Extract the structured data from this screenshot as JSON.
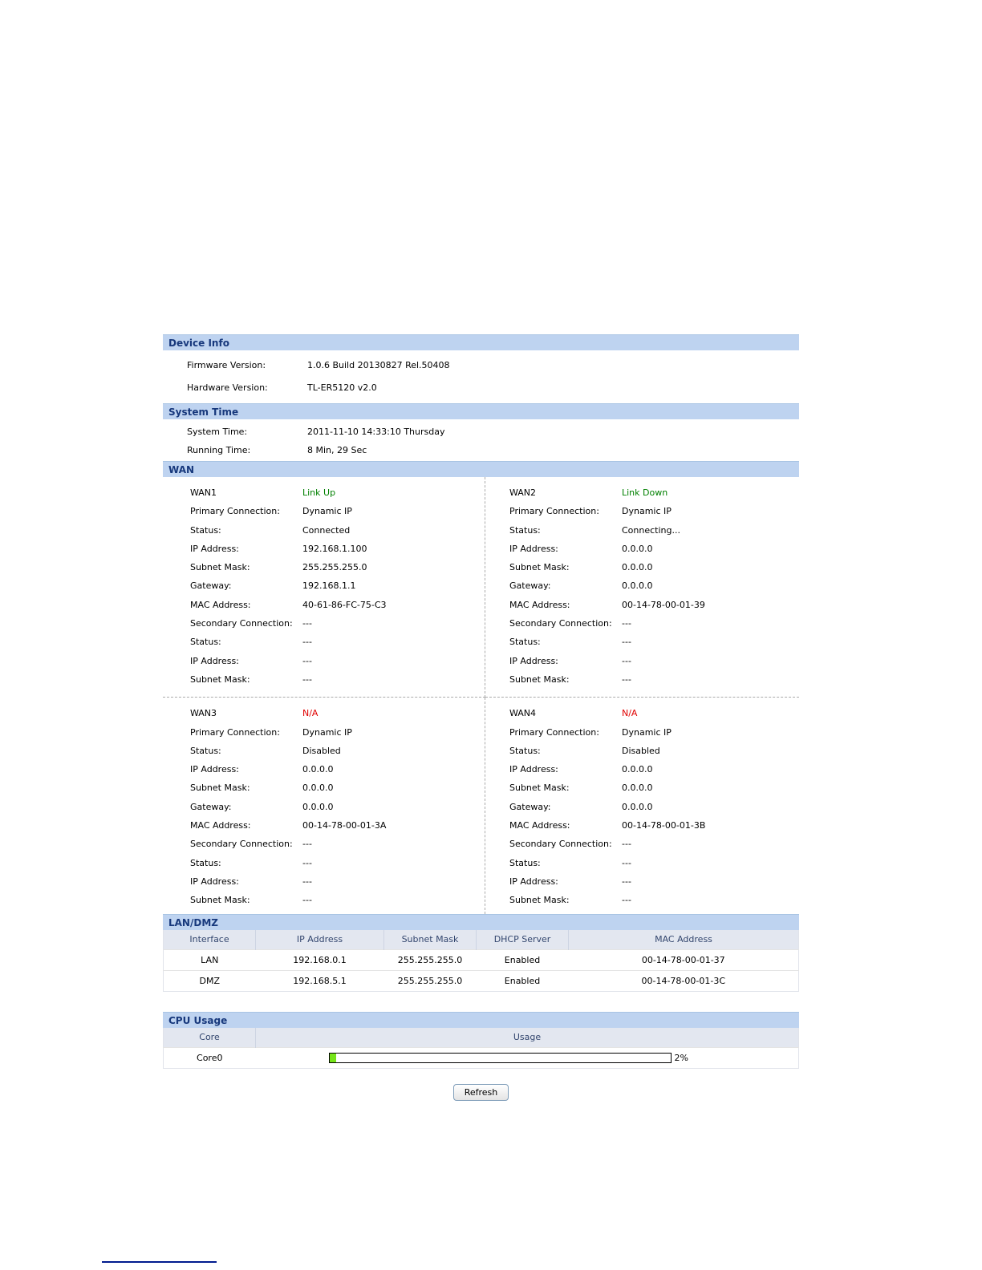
{
  "colors": {
    "section_header_bg": "#bed3f0",
    "section_header_text": "#17387c",
    "table_header_bg": "#e3e7f0",
    "link_active": "#008000",
    "link_na": "#e00000",
    "cpu_bar_fill": "#76e419",
    "bottom_line": "#001b8d"
  },
  "device_info": {
    "title": "Device Info",
    "rows": [
      {
        "label": "Firmware Version:",
        "value": "1.0.6 Build 20130827 Rel.50408"
      },
      {
        "label": "Hardware Version:",
        "value": "TL-ER5120 v2.0"
      }
    ]
  },
  "system_time": {
    "title": "System Time",
    "rows": [
      {
        "label": "System Time:",
        "value": "2011-11-10 14:33:10 Thursday"
      },
      {
        "label": "Running Time:",
        "value": "8 Min, 29 Sec"
      }
    ]
  },
  "wan": {
    "title": "WAN",
    "ports": [
      {
        "name": "WAN1",
        "link": "Link Up",
        "status_color": "#008000",
        "rows": [
          {
            "label": "Primary Connection:",
            "value": "Dynamic IP"
          },
          {
            "label": "Status:",
            "value": "Connected"
          },
          {
            "label": "IP Address:",
            "value": "192.168.1.100"
          },
          {
            "label": "Subnet Mask:",
            "value": "255.255.255.0"
          },
          {
            "label": "Gateway:",
            "value": "192.168.1.1"
          },
          {
            "label": "MAC Address:",
            "value": "40-61-86-FC-75-C3"
          },
          {
            "label": "Secondary Connection:",
            "value": "---"
          },
          {
            "label": "Status:",
            "value": "---"
          },
          {
            "label": "IP Address:",
            "value": "---"
          },
          {
            "label": "Subnet Mask:",
            "value": "---"
          }
        ]
      },
      {
        "name": "WAN2",
        "link": "Link Down",
        "status_color": "#008000",
        "rows": [
          {
            "label": "Primary Connection:",
            "value": "Dynamic IP"
          },
          {
            "label": "Status:",
            "value": "Connecting..."
          },
          {
            "label": "IP Address:",
            "value": "0.0.0.0"
          },
          {
            "label": "Subnet Mask:",
            "value": "0.0.0.0"
          },
          {
            "label": "Gateway:",
            "value": "0.0.0.0"
          },
          {
            "label": "MAC Address:",
            "value": "00-14-78-00-01-39"
          },
          {
            "label": "Secondary Connection:",
            "value": "---"
          },
          {
            "label": "Status:",
            "value": "---"
          },
          {
            "label": "IP Address:",
            "value": "---"
          },
          {
            "label": "Subnet Mask:",
            "value": "---"
          }
        ]
      },
      {
        "name": "WAN3",
        "link": "N/A",
        "status_color": "#e00000",
        "rows": [
          {
            "label": "Primary Connection:",
            "value": "Dynamic IP"
          },
          {
            "label": "Status:",
            "value": "Disabled"
          },
          {
            "label": "IP Address:",
            "value": "0.0.0.0"
          },
          {
            "label": "Subnet Mask:",
            "value": "0.0.0.0"
          },
          {
            "label": "Gateway:",
            "value": "0.0.0.0"
          },
          {
            "label": "MAC Address:",
            "value": "00-14-78-00-01-3A"
          },
          {
            "label": "Secondary Connection:",
            "value": "---"
          },
          {
            "label": "Status:",
            "value": "---"
          },
          {
            "label": "IP Address:",
            "value": "---"
          },
          {
            "label": "Subnet Mask:",
            "value": "---"
          }
        ]
      },
      {
        "name": "WAN4",
        "link": "N/A",
        "status_color": "#e00000",
        "rows": [
          {
            "label": "Primary Connection:",
            "value": "Dynamic IP"
          },
          {
            "label": "Status:",
            "value": "Disabled"
          },
          {
            "label": "IP Address:",
            "value": "0.0.0.0"
          },
          {
            "label": "Subnet Mask:",
            "value": "0.0.0.0"
          },
          {
            "label": "Gateway:",
            "value": "0.0.0.0"
          },
          {
            "label": "MAC Address:",
            "value": "00-14-78-00-01-3B"
          },
          {
            "label": "Secondary Connection:",
            "value": "---"
          },
          {
            "label": "Status:",
            "value": "---"
          },
          {
            "label": "IP Address:",
            "value": "---"
          },
          {
            "label": "Subnet Mask:",
            "value": "---"
          }
        ]
      }
    ]
  },
  "lan_dmz": {
    "title": "LAN/DMZ",
    "headers": [
      "Interface",
      "IP Address",
      "Subnet Mask",
      "DHCP Server",
      "MAC Address"
    ],
    "rows": [
      [
        "LAN",
        "192.168.0.1",
        "255.255.255.0",
        "Enabled",
        "00-14-78-00-01-37"
      ],
      [
        "DMZ",
        "192.168.5.1",
        "255.255.255.0",
        "Enabled",
        "00-14-78-00-01-3C"
      ]
    ]
  },
  "cpu": {
    "title": "CPU Usage",
    "headers": [
      "Core",
      "Usage"
    ],
    "rows": [
      {
        "core": "Core0",
        "usage": "2%"
      }
    ]
  },
  "actions": {
    "refresh_label": "Refresh"
  }
}
